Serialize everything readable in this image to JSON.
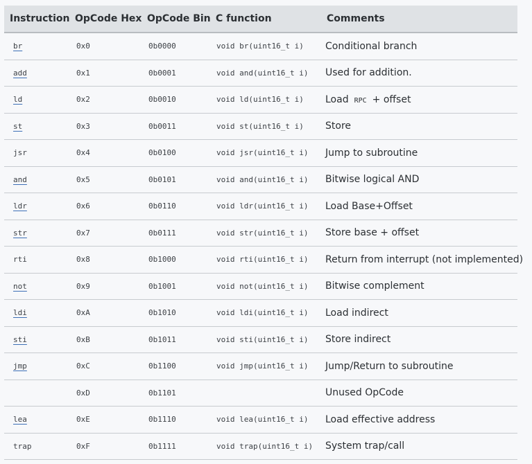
{
  "table": {
    "headers": [
      "Instruction",
      "OpCode Hex",
      "OpCode Bin",
      "C function",
      "Comments"
    ],
    "rows": [
      {
        "instruction": "br",
        "linked": true,
        "hex": "0x0",
        "bin": "0b0000",
        "cfunc": "void br(uint16_t i)",
        "comment": "Conditional branch",
        "comment_code": "",
        "comment_after": ""
      },
      {
        "instruction": "add",
        "linked": true,
        "hex": "0x1",
        "bin": "0b0001",
        "cfunc": "void and(uint16_t i)",
        "comment": "Used for addition.",
        "comment_code": "",
        "comment_after": ""
      },
      {
        "instruction": "ld",
        "linked": true,
        "hex": "0x2",
        "bin": "0b0010",
        "cfunc": "void ld(uint16_t i)",
        "comment": "Load",
        "comment_code": "RPC",
        "comment_after": "+ offset"
      },
      {
        "instruction": "st",
        "linked": true,
        "hex": "0x3",
        "bin": "0b0011",
        "cfunc": "void st(uint16_t i)",
        "comment": "Store",
        "comment_code": "",
        "comment_after": ""
      },
      {
        "instruction": "jsr",
        "linked": false,
        "hex": "0x4",
        "bin": "0b0100",
        "cfunc": "void jsr(uint16_t i)",
        "comment": "Jump to subroutine",
        "comment_code": "",
        "comment_after": ""
      },
      {
        "instruction": "and",
        "linked": true,
        "hex": "0x5",
        "bin": "0b0101",
        "cfunc": "void and(uint16_t i)",
        "comment": "Bitwise logical AND",
        "comment_code": "",
        "comment_after": ""
      },
      {
        "instruction": "ldr",
        "linked": true,
        "hex": "0x6",
        "bin": "0b0110",
        "cfunc": "void ldr(uint16_t i)",
        "comment": "Load Base+Offset",
        "comment_code": "",
        "comment_after": ""
      },
      {
        "instruction": "str",
        "linked": true,
        "hex": "0x7",
        "bin": "0b0111",
        "cfunc": "void str(uint16_t i)",
        "comment": "Store base + offset",
        "comment_code": "",
        "comment_after": ""
      },
      {
        "instruction": "rti",
        "linked": false,
        "hex": "0x8",
        "bin": "0b1000",
        "cfunc": "void rti(uint16_t i)",
        "comment": "Return from interrupt (not implemented)",
        "comment_code": "",
        "comment_after": ""
      },
      {
        "instruction": "not",
        "linked": true,
        "hex": "0x9",
        "bin": "0b1001",
        "cfunc": "void not(uint16_t i)",
        "comment": "Bitwise complement",
        "comment_code": "",
        "comment_after": ""
      },
      {
        "instruction": "ldi",
        "linked": true,
        "hex": "0xA",
        "bin": "0b1010",
        "cfunc": "void ldi(uint16_t i)",
        "comment": "Load indirect",
        "comment_code": "",
        "comment_after": ""
      },
      {
        "instruction": "sti",
        "linked": true,
        "hex": "0xB",
        "bin": "0b1011",
        "cfunc": "void sti(uint16_t i)",
        "comment": "Store indirect",
        "comment_code": "",
        "comment_after": ""
      },
      {
        "instruction": "jmp",
        "linked": true,
        "hex": "0xC",
        "bin": "0b1100",
        "cfunc": "void jmp(uint16_t i)",
        "comment": "Jump/Return to subroutine",
        "comment_code": "",
        "comment_after": ""
      },
      {
        "instruction": "",
        "linked": false,
        "hex": "0xD",
        "bin": "0b1101",
        "cfunc": "",
        "comment": "Unused OpCode",
        "comment_code": "",
        "comment_after": ""
      },
      {
        "instruction": "lea",
        "linked": true,
        "hex": "0xE",
        "bin": "0b1110",
        "cfunc": "void lea(uint16_t i)",
        "comment": "Load effective address",
        "comment_code": "",
        "comment_after": ""
      },
      {
        "instruction": "trap",
        "linked": false,
        "hex": "0xF",
        "bin": "0b1111",
        "cfunc": "void trap(uint16_t i)",
        "comment": "System trap/call",
        "comment_code": "",
        "comment_after": ""
      }
    ]
  },
  "colors": {
    "header_bg": "#dfe2e5",
    "page_bg": "#f7f8fa",
    "link_underline": "#3d6fb6",
    "row_border": "#c7cbcf"
  }
}
